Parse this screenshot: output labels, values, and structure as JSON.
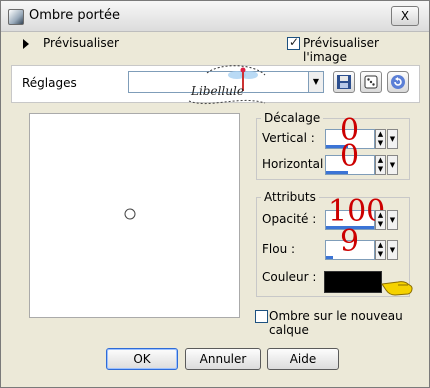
{
  "window": {
    "title": "Ombre portée",
    "close_label": "X"
  },
  "preview_row": {
    "label": "Prévisualiser",
    "checkbox_label": "Prévisualiser l'image",
    "checked": true
  },
  "settings": {
    "label": "Réglages",
    "preset_value": ""
  },
  "logo_text": "Libellule",
  "decalage": {
    "title": "Décalage",
    "vertical": {
      "label": "Vertical :",
      "value": "0"
    },
    "horizontal": {
      "label": "Horizontal :",
      "value": "0"
    }
  },
  "attributs": {
    "title": "Attributs",
    "opacity": {
      "label": "Opacité :",
      "value": "100"
    },
    "blur": {
      "label": "Flou :",
      "value": "9"
    },
    "color": {
      "label": "Couleur :",
      "value": "#000000"
    }
  },
  "ombre_nouveau_calque": {
    "label": "Ombre sur le nouveau calque",
    "checked": false
  },
  "buttons": {
    "ok": "OK",
    "cancel": "Annuler",
    "help": "Aide"
  },
  "icons": {
    "app": "app-icon",
    "save": "save-icon",
    "dice": "dice-icon",
    "reset": "reset-icon",
    "pointer": "pointing-hand-icon"
  },
  "colors": {
    "accent": "#3b74d6",
    "value_text": "#cc0000",
    "shadow_color": "#000000"
  }
}
